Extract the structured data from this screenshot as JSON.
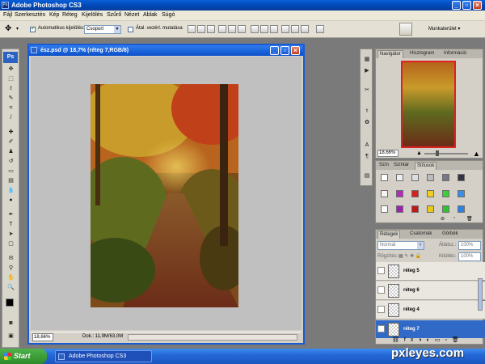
{
  "window": {
    "title": "Adobe Photoshop CS3",
    "app_icon": "Ps"
  },
  "menu": [
    "Fájl",
    "Szerkesztés",
    "Kép",
    "Réteg",
    "Kijelölés",
    "Szűrő",
    "Nézet",
    "Ablak",
    "Súgó"
  ],
  "options": {
    "auto_select_label": "Automatikus kijelölés:",
    "auto_select_checked": true,
    "group_value": "Csoport",
    "transform_label": "Átal. vezérl. mutatása",
    "transform_checked": false,
    "workspace_label": "Munkaterület ▾"
  },
  "toolbox": {
    "logo": "Ps"
  },
  "document": {
    "title": "ész.psd @ 18,7% (réteg 7,RGB/8)",
    "zoom": "18,66%",
    "doc_info": "Dok.: 11,9M/63,0M"
  },
  "navigator": {
    "tabs": [
      "Navigátor",
      "Hisztogram",
      "Információ"
    ],
    "zoom": "18,66%"
  },
  "swatches_panel": {
    "tabs": [
      "Szín",
      "Színtár",
      "Stílusok"
    ]
  },
  "layers_panel": {
    "tabs": [
      "Rétegek",
      "Csatornák",
      "Görbék"
    ],
    "blend_mode": "Normál",
    "opacity_label": "Átlátsz.:",
    "opacity_value": "100%",
    "lock_label": "Rögzítés:",
    "fill_label": "Kitöltés:",
    "fill_value": "100%",
    "layers": [
      {
        "name": "réteg 5",
        "selected": false
      },
      {
        "name": "réteg 6",
        "selected": false
      },
      {
        "name": "réteg 4",
        "selected": false
      },
      {
        "name": "réteg 7",
        "selected": true
      }
    ]
  },
  "taskbar": {
    "start_label": "Start",
    "task_label": "Adobe Photoshop CS3"
  },
  "watermark": "pxleyes.com",
  "colors": {
    "xp_blue": "#0a5fd8",
    "layer_selected": "#3169c6",
    "start_green": "#3c9e37"
  }
}
